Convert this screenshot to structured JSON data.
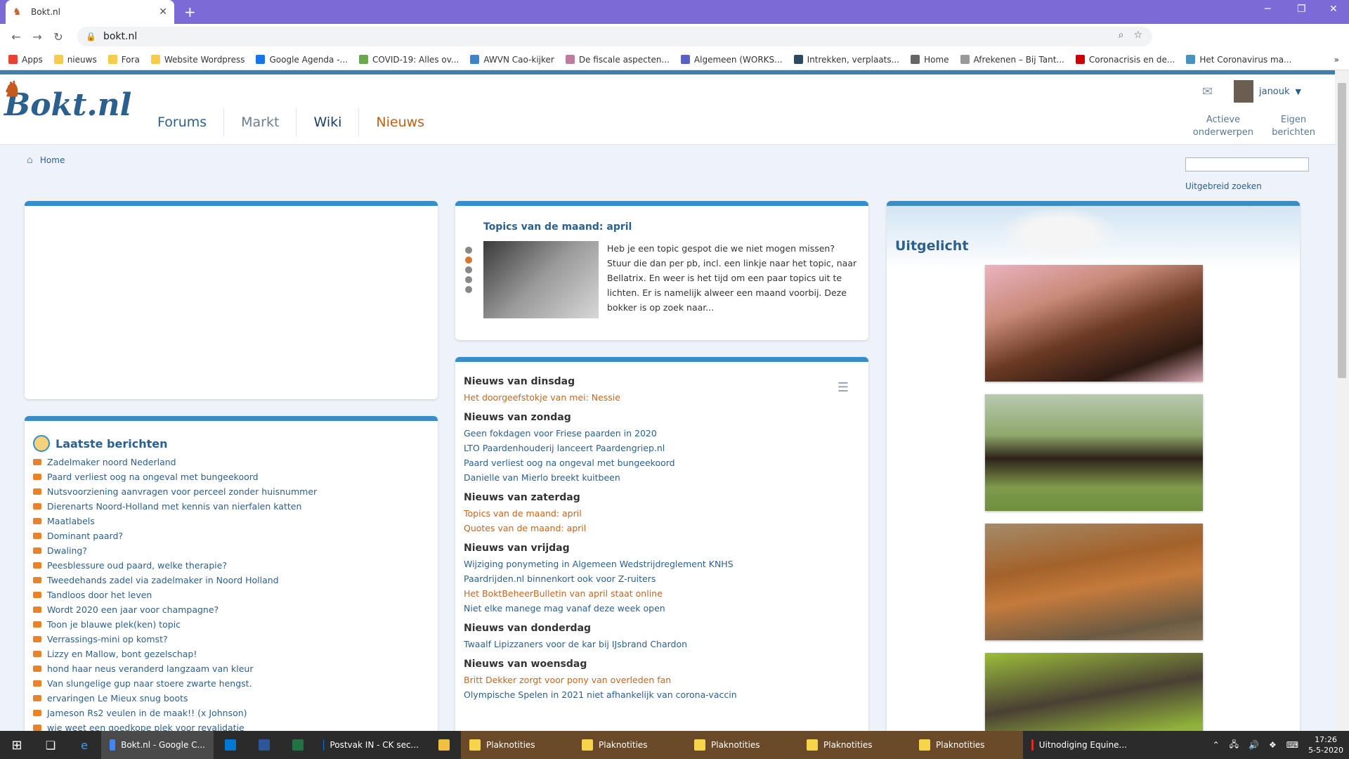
{
  "browser": {
    "tab_title": "Bokt.nl",
    "url": "bokt.nl",
    "bookmarks": [
      {
        "label": "Apps",
        "color": "#e94235"
      },
      {
        "label": "nieuws",
        "color": "#f7cb4d"
      },
      {
        "label": "Fora",
        "color": "#f7cb4d"
      },
      {
        "label": "Website Wordpress",
        "color": "#f7cb4d"
      },
      {
        "label": "Google Agenda -...",
        "color": "#1a73e8"
      },
      {
        "label": "COVID-19: Alles ov...",
        "color": "#6aa84f"
      },
      {
        "label": "AWVN Cao-kijker",
        "color": "#3d85c6"
      },
      {
        "label": "De fiscale aspecten...",
        "color": "#c27ba0"
      },
      {
        "label": "Algemeen (WORKS...",
        "color": "#5b5fc7"
      },
      {
        "label": "Intrekken, verplaats...",
        "color": "#2e4a62"
      },
      {
        "label": "Home",
        "color": "#666666"
      },
      {
        "label": "Afrekenen – Bij Tant...",
        "color": "#999999"
      },
      {
        "label": "Coronacrisis en de...",
        "color": "#cc0000"
      },
      {
        "label": "Het Coronavirus ma...",
        "color": "#4a90c2"
      }
    ]
  },
  "site": {
    "logo": "Bokt.nl",
    "nav": [
      "Forums",
      "Markt",
      "Wiki",
      "Nieuws"
    ],
    "username": "janouk",
    "quicklinks": [
      {
        "line1": "Actieve",
        "line2": "onderwerpen"
      },
      {
        "line1": "Eigen",
        "line2": "berichten"
      }
    ],
    "breadcrumb": "Home",
    "advanced_search": "Uitgebreid zoeken"
  },
  "topics": {
    "title": "Topics van de maand: april",
    "text": "Heb je een topic gespot die we niet mogen missen? Stuur die dan per pb, incl. een linkje naar het topic, naar Bellatrix. En weer is het tijd om een paar topics uit te lichten. Er is namelijk alweer een maand voorbij. Deze bokker is op zoek naar..."
  },
  "news": [
    {
      "day": "Nieuws van dinsdag",
      "items": [
        {
          "text": "Het doorgeefstokje van mei: Nessie",
          "orange": true
        }
      ]
    },
    {
      "day": "Nieuws van zondag",
      "items": [
        {
          "text": "Geen fokdagen voor Friese paarden in 2020",
          "orange": false
        },
        {
          "text": "LTO Paardenhouderij lanceert Paardengriep.nl",
          "orange": false
        },
        {
          "text": "Paard verliest oog na ongeval met bungeekoord",
          "orange": false
        },
        {
          "text": "Danielle van Mierlo breekt kuitbeen",
          "orange": false
        }
      ]
    },
    {
      "day": "Nieuws van zaterdag",
      "items": [
        {
          "text": "Topics van de maand: april",
          "orange": true
        },
        {
          "text": "Quotes van de maand: april",
          "orange": true
        }
      ]
    },
    {
      "day": "Nieuws van vrijdag",
      "items": [
        {
          "text": "Wijziging ponymeting in Algemeen Wedstrijdreglement KNHS",
          "orange": false
        },
        {
          "text": "Paardrijden.nl binnenkort ook voor Z-ruiters",
          "orange": false
        },
        {
          "text": "Het BoktBeheerBulletin van april staat online",
          "orange": true
        },
        {
          "text": "Niet elke manege mag vanaf deze week open",
          "orange": false
        }
      ]
    },
    {
      "day": "Nieuws van donderdag",
      "items": [
        {
          "text": "Twaalf Lipizzaners voor de kar bij IJsbrand Chardon",
          "orange": false
        }
      ]
    },
    {
      "day": "Nieuws van woensdag",
      "items": [
        {
          "text": "Britt Dekker zorgt voor pony van overleden fan",
          "orange": true
        },
        {
          "text": "Olympische Spelen in 2021 niet afhankelijk van corona-vaccin",
          "orange": false
        }
      ]
    }
  ],
  "featured": {
    "title": "Uitgelicht"
  },
  "latest": {
    "title": "Laatste berichten",
    "items": [
      "Zadelmaker noord Nederland",
      "Paard verliest oog na ongeval met bungeekoord",
      "Nutsvoorziening aanvragen voor perceel zonder huisnummer",
      "Dierenarts Noord-Holland met kennis van nierfalen katten",
      "Maatlabels",
      "Dominant paard?",
      "Dwaling?",
      "Peesblessure oud paard, welke therapie?",
      "Tweedehands zadel via zadelmaker in Noord Holland",
      "Tandloos door het leven",
      "Wordt 2020 een jaar voor champagne?",
      "Toon je blauwe plek(ken) topic",
      "Verrassings-mini op komst?",
      "Lizzy en Mallow, bont gezelschap!",
      "hond haar neus veranderd langzaam van kleur",
      "Van slungelige gup naar stoere zwarte hengst.",
      "ervaringen Le Mieux snug boots",
      "Jameson Rs2 veulen in de maak!! (x Johnson)",
      "wie weet een goedkope plek voor revalidatie"
    ]
  },
  "taskbar": {
    "apps": [
      {
        "label": "Bokt.nl - Google C...",
        "color": "#4285f4",
        "active": true
      },
      {
        "label": "",
        "color": "#0078d4",
        "active": false
      },
      {
        "label": "",
        "color": "#2b579a",
        "active": false
      },
      {
        "label": "",
        "color": "#217346",
        "active": false
      },
      {
        "label": "Postvak IN - CK sec...",
        "color": "#0072c6",
        "active": false
      },
      {
        "label": "",
        "color": "#f0c040",
        "active": false
      },
      {
        "label": "Plaknotities",
        "color": "#f7d54a",
        "active": false
      },
      {
        "label": "Plaknotities",
        "color": "#f7d54a",
        "active": false
      },
      {
        "label": "Plaknotities",
        "color": "#f7d54a",
        "active": false
      },
      {
        "label": "Plaknotities",
        "color": "#f7d54a",
        "active": false
      },
      {
        "label": "Plaknotities",
        "color": "#f7d54a",
        "active": false
      },
      {
        "label": "Uitnodiging Equine...",
        "color": "#d93025",
        "active": false
      }
    ],
    "time": "17:26",
    "date": "5-5-2020"
  }
}
